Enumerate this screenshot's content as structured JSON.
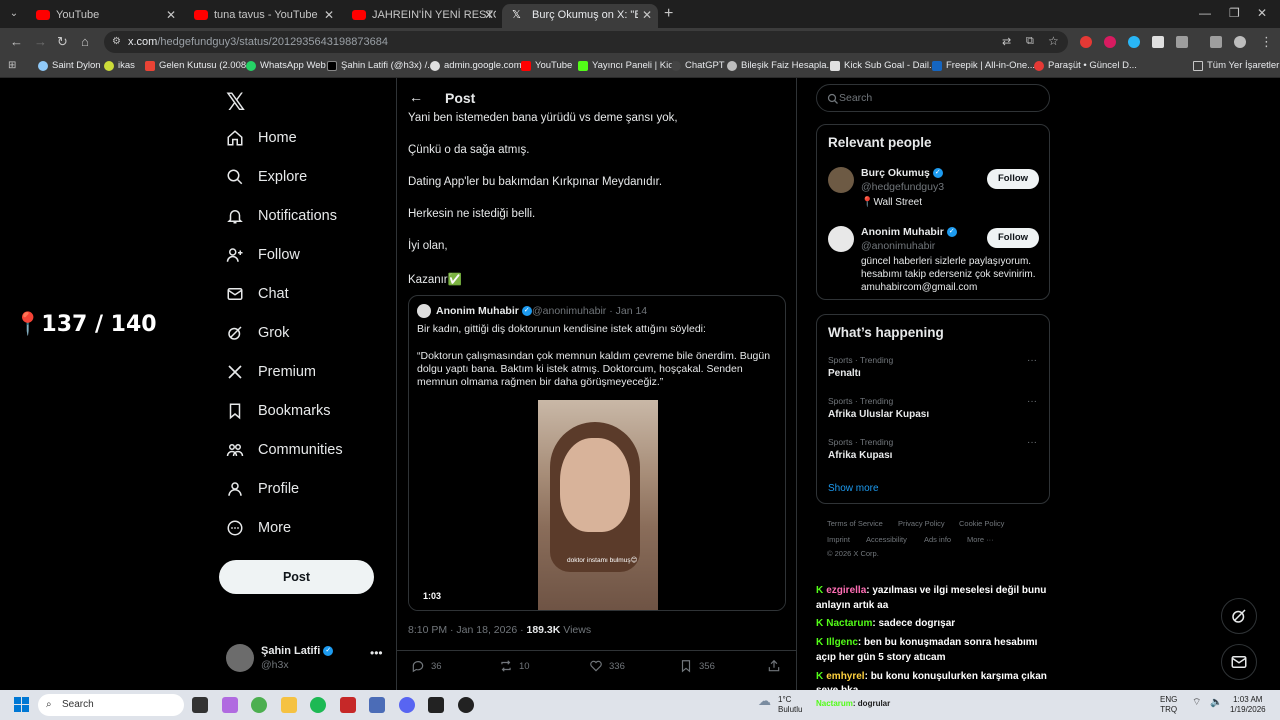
{
  "browser": {
    "tabs": [
      {
        "label": "YouTube",
        "icon": "youtube"
      },
      {
        "label": "tuna tavus - YouTube",
        "icon": "youtube"
      },
      {
        "label": "JAHREIN'İN YENİ RESTORANINA",
        "icon": "youtube"
      },
      {
        "label": "Burç Okumuş on X: \"Bakın insan",
        "icon": "x"
      }
    ],
    "url_domain": "x.com",
    "url_path": "/hedgefundguy3/status/2012935643198873684",
    "bookmarks": [
      "Saint Dylon",
      "ikas",
      "Gelen Kutusu (2.008...",
      "WhatsApp Web",
      "Şahin Latifi (@h3x) /...",
      "admin.google.com",
      "YouTube",
      "Yayıncı Paneli | Kick",
      "ChatGPT",
      "Bileşik Faiz Hesapla...",
      "Kick Sub Goal - Dail...",
      "Freepik | All-in-One...",
      "Paraşüt • Güncel D..."
    ],
    "all_bookmarks": "Tüm Yer İşaretleri"
  },
  "overlay": {
    "counter": "137 / 140"
  },
  "nav": {
    "items": [
      "Home",
      "Explore",
      "Notifications",
      "Follow",
      "Chat",
      "Grok",
      "Premium",
      "Bookmarks",
      "Communities",
      "Profile",
      "More"
    ],
    "post_button": "Post",
    "account": {
      "name": "Şahin Latifi",
      "handle": "@h3x",
      "more": "•••"
    }
  },
  "post": {
    "header": "Post",
    "lines": [
      "Yani ben istemeden bana yürüdü vs deme şansı yok,",
      "Çünkü o da sağa atmış.",
      "Dating App'ler bu bakımdan Kırkpınar Meydanıdır.",
      "Herkesin ne istediği belli.",
      "İyi olan,",
      "Kazanır✅"
    ],
    "quote": {
      "name": "Anonim Muhabir",
      "handle": "@anonimuhabir · Jan 14",
      "text1": "Bir kadın, gittiği diş doktorunun kendisine istek attığını söyledi:",
      "text2": "“Doktorun çalışmasından çok memnun kaldım çevreme bile önerdim. Bugün",
      "text3": "dolgu yaptı bana. Baktım ki istek atmış. Doktorcum, hoşçakal. Senden",
      "text4": "memnun olmama rağmen bir daha görüşmeyeceğiz.”",
      "video_caption": "doktor instamı bulmuş😊",
      "video_duration": "1:03"
    },
    "meta_time": "8:10 PM · Jan 18, 2026 · ",
    "meta_views": "189.3K",
    "meta_views_label": " Views",
    "actions": {
      "replies": "36",
      "reposts": "10",
      "likes": "336",
      "bookmarks": "356"
    }
  },
  "right": {
    "search_placeholder": "Search",
    "relevant_title": "Relevant people",
    "people": [
      {
        "name": "Burç Okumuş",
        "handle": "@hedgefundguy3",
        "bio": "📍Wall Street",
        "follow": "Follow"
      },
      {
        "name": "Anonim Muhabir",
        "handle": "@anonimuhabir",
        "bio": "güncel haberleri sizlerle paylaşıyorum. hesabımı takip ederseniz çok sevinirim. amuhabircom@gmail.com",
        "follow": "Follow"
      }
    ],
    "happening_title": "What’s happening",
    "trends": [
      {
        "context": "Sports · Trending",
        "title": "Penaltı"
      },
      {
        "context": "Sports · Trending",
        "title": "Afrika Uluslar Kupası"
      },
      {
        "context": "Sports · Trending",
        "title": "Afrika Kupası"
      }
    ],
    "show_more": "Show more",
    "footer": [
      "Terms of Service",
      "Privacy Policy",
      "Cookie Policy",
      "Imprint",
      "Accessibility",
      "Ads info",
      "More ···",
      "© 2026 X Corp."
    ]
  },
  "chat": [
    {
      "user": "ezgirella",
      "color": "#ff6fb5",
      "msg": ": yazılması ve ilgi meselesi değil bunu"
    },
    {
      "user": "",
      "color": "#fff",
      "msg": "anlayın artık aa"
    },
    {
      "user": "Nactarum",
      "color": "#53fc18",
      "msg": ": sadece dogrışar"
    },
    {
      "user": "Illgenc",
      "color": "#53fc18",
      "msg": ": ben bu konuşmadan sonra hesabımı"
    },
    {
      "user": "",
      "color": "#fff",
      "msg": "açıp her gün 5 story atıcam"
    },
    {
      "user": "emhyrel",
      "color": "#ffd23f",
      "msg": ": bu konu konuşulurken karşıma çıkan"
    },
    {
      "user": "",
      "color": "#fff",
      "msg": "şeye bka"
    }
  ],
  "taskbar": {
    "search": "Search",
    "weather_temp": "1°C",
    "weather_label": "Bulutlu",
    "lang1": "ENG",
    "lang2": "TRQ",
    "time": "1:03 AM",
    "date": "1/19/2026",
    "ticker_user": "Nactarum",
    "ticker_msg": ": dogrular"
  }
}
